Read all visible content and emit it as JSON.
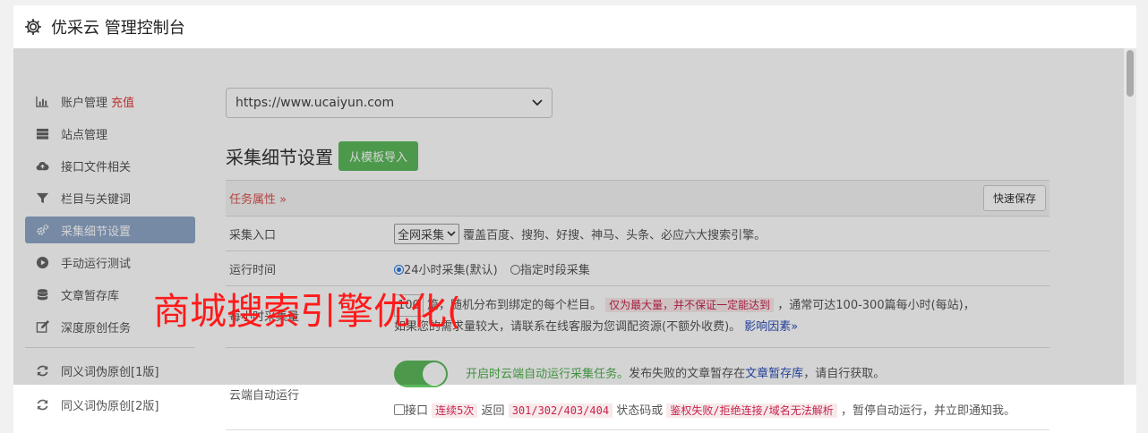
{
  "header": {
    "title": "优采云 管理控制台",
    "icon": "gear-icon"
  },
  "sidebar": {
    "items": [
      {
        "label": "账户管理",
        "badge": "充值",
        "icon": "bar-chart-icon"
      },
      {
        "label": "站点管理",
        "icon": "server-icon"
      },
      {
        "label": "接口文件相关",
        "icon": "cloud-upload-icon"
      },
      {
        "label": "栏目与关键词",
        "icon": "filter-icon"
      },
      {
        "label": "采集细节设置",
        "icon": "cogs-icon",
        "active": true
      },
      {
        "label": "手动运行测试",
        "icon": "play-circle-icon"
      },
      {
        "label": "文章暂存库",
        "icon": "database-icon"
      },
      {
        "label": "深度原创任务",
        "icon": "edit-icon"
      }
    ],
    "extra_items": [
      {
        "label": "同义词伪原创[1版]",
        "icon": "refresh-icon"
      },
      {
        "label": "同义词伪原创[2版]",
        "icon": "refresh-icon"
      }
    ]
  },
  "main": {
    "site_select": "https://www.ucaiyun.com",
    "section_title": "采集细节设置",
    "import_button": "从模板导入",
    "task_attr": "任务属性 »",
    "quick_save": "快速保存",
    "rows": {
      "entry": {
        "label": "采集入口",
        "select": "全网采集",
        "desc": "覆盖百度、搜狗、好搜、神马、头条、必应六大搜索引擎。"
      },
      "runtime": {
        "label": "运行时间",
        "opt1": "24小时采集(默认)",
        "opt2": "指定时段采集"
      },
      "volume": {
        "label": "每小时采集量",
        "num": "100",
        "text1": "篇，随机分布到绑定的每个栏目。",
        "warn": "仅为最大量，并不保证一定能达到",
        "text2": "，通常可达100-300篇每小时(每站)，",
        "text3": "如果您的需求量较大，请联系在线客服为您调配资源(不额外收费)。",
        "link": "影响因素»"
      },
      "cloud": {
        "label": "云端自动运行",
        "toggle_text": "开启时云端自动运行采集任务。",
        "desc": "发布失败的文章暂存在",
        "link": "文章暂存库",
        "desc2": "，请自行获取。",
        "cb_text1": "接口",
        "warn1": "连续5次",
        "cb_text2": "返回",
        "warn2": "301/302/403/404",
        "cb_text3": "状态码或",
        "warn3": "鉴权失败/拒绝连接/域名无法解析",
        "cb_text4": "，暂停自动运行，并立即通知我。"
      }
    }
  },
  "watermark": "商城搜索引擎优化(",
  "colors": {
    "accent_green": "#5cb85c",
    "active_nav": "#8fa7c7",
    "watermark": "#ff1a1a"
  }
}
